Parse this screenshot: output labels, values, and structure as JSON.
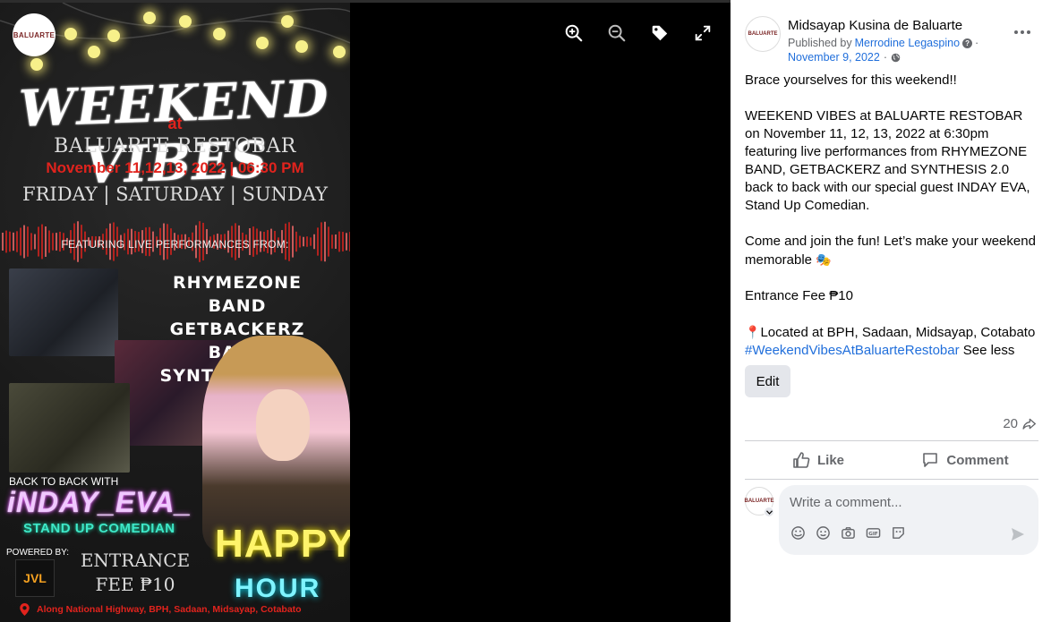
{
  "viewer": {
    "toolbar": {
      "zoom_in": "zoom-in-icon",
      "zoom_out": "zoom-out-icon",
      "tag": "tag-icon",
      "fullscreen": "fullscreen-icon"
    }
  },
  "poster": {
    "logo_text": "BALUARTE",
    "title": "WEEKEND VIBES",
    "at": "at",
    "venue": "BALUARTE RESTOBAR",
    "date": "November 11,12,13, 2022 | 06:30 PM",
    "days": "FRIDAY | SATURDAY | SUNDAY",
    "featuring": "FEATURING LIVE PERFORMANCES FROM:",
    "bands": [
      "RHYMEZONE BAND",
      "GETBACKERZ BAND",
      "SYNTHESIS 2.0"
    ],
    "back_to_back": "BACK TO BACK WITH",
    "guest": "iNDAY_EVA_",
    "guest_role": "STAND UP COMEDIAN",
    "powered_by": "POWERED BY:",
    "sponsor": "JVL",
    "fee_line1": "ENTRANCE",
    "fee_line2": "FEE ₱10",
    "happy": "HAPPY",
    "hour": "HOUR",
    "address": "Along National Highway, BPH, Sadaan, Midsayap, Cotabato",
    "colors": {
      "accent_red": "#e1231d",
      "neon_pink": "#e040fb",
      "neon_teal": "#1de9b6",
      "neon_yellow": "#f7ea00",
      "neon_cyan": "#00e5ff"
    }
  },
  "post": {
    "page_name": "Midsayap Kusina de Baluarte",
    "published_by_prefix": "Published by",
    "publisher": "Merrodine Legaspino",
    "date": "November 9, 2022",
    "paragraph1": "Brace yourselves for this weekend!!",
    "paragraph2": "WEEKEND VIBES at BALUARTE RESTOBAR on November 11, 12, 13, 2022 at 6:30pm featuring live performances from RHYMEZONE BAND, GETBACKERZ and SYNTHESIS 2.0 back to back with our special guest INDAY EVA, Stand Up Comedian.",
    "paragraph3": "Come and join the fun! Let’s make your weekend memorable",
    "paragraph3_emoji": "🎭",
    "paragraph4": "Entrance Fee ₱10",
    "location_emoji": "📍",
    "location": "Located at BPH, Sadaan, Midsayap, Cotabato",
    "hashtag": "#WeekendVibesAtBaluarteRestobar",
    "see_less": "See less",
    "edit_label": "Edit",
    "share_count": "20",
    "like_label": "Like",
    "comment_label": "Comment",
    "comment_placeholder": "Write a comment...",
    "link_color": "#216fdb"
  }
}
